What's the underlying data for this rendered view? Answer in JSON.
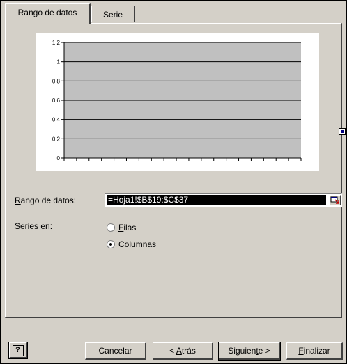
{
  "tabs": [
    {
      "label": "Rango de datos",
      "active": true
    },
    {
      "label": "Serie",
      "active": false
    }
  ],
  "preview": {
    "y_ticks": [
      "1,2",
      "1",
      "0,8",
      "0,6",
      "0,4",
      "0,2",
      "0"
    ],
    "plot_color": "#c0c0c0",
    "legend_icon": "series-marker-icon"
  },
  "range": {
    "label_pre": "",
    "label_access": "R",
    "label_post": "ango de datos:",
    "value": "=Hoja1!$B$19:$C$37",
    "collapse_icon": "collapse-dialog-icon"
  },
  "series_in": {
    "label": "Series en:",
    "options": [
      {
        "pre": "",
        "access": "F",
        "post": "ilas",
        "checked": false
      },
      {
        "pre": "Colu",
        "access": "m",
        "post": "nas",
        "checked": true
      }
    ]
  },
  "buttons": {
    "help_icon": "help-icon",
    "help_glyph": "?",
    "cancel": {
      "pre": "Cancelar",
      "access": "",
      "post": ""
    },
    "back": {
      "pre": "< ",
      "access": "A",
      "post": "trás"
    },
    "next": {
      "pre": "Siguien",
      "access": "t",
      "post": "e >"
    },
    "finish": {
      "pre": "",
      "access": "F",
      "post": "inalizar"
    }
  }
}
